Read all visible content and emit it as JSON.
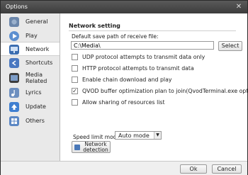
{
  "window": {
    "title": "Options"
  },
  "sidebar": {
    "items": [
      {
        "label": "General",
        "icon": "gear-icon"
      },
      {
        "label": "Play",
        "icon": "play-icon"
      },
      {
        "label": "Network",
        "icon": "network-icon",
        "active": true
      },
      {
        "label": "Shortcuts",
        "icon": "shortcut-icon"
      },
      {
        "label": "Media",
        "label2": "Related",
        "icon": "media-icon"
      },
      {
        "label": "Lyrics",
        "icon": "lyrics-icon"
      },
      {
        "label": "Update",
        "icon": "update-icon"
      },
      {
        "label": "Others",
        "icon": "others-icon"
      }
    ]
  },
  "network": {
    "section_title": "Network setting",
    "path_label": "Default save path of receive file:",
    "path_value": "C:\\Media\\",
    "select_label": "Select",
    "options": [
      {
        "label": "UDP protocol attempts to transmit data only",
        "checked": false
      },
      {
        "label": "HTTP protocol attempts to transmit data",
        "checked": false
      },
      {
        "label": "Enable chain download and play",
        "checked": false
      },
      {
        "label": "QVOD buffer optimization plan to join(QvodTerminal.exe option)",
        "checked": true
      },
      {
        "label": "Allow sharing of resources list",
        "checked": false
      }
    ],
    "speed_label": "Speed limit mode:",
    "speed_value": "Auto mode",
    "detect_label_1": "Network",
    "detect_label_2": "detection"
  },
  "footer": {
    "ok_label": "Ok",
    "cancel_label": "Cancel"
  }
}
